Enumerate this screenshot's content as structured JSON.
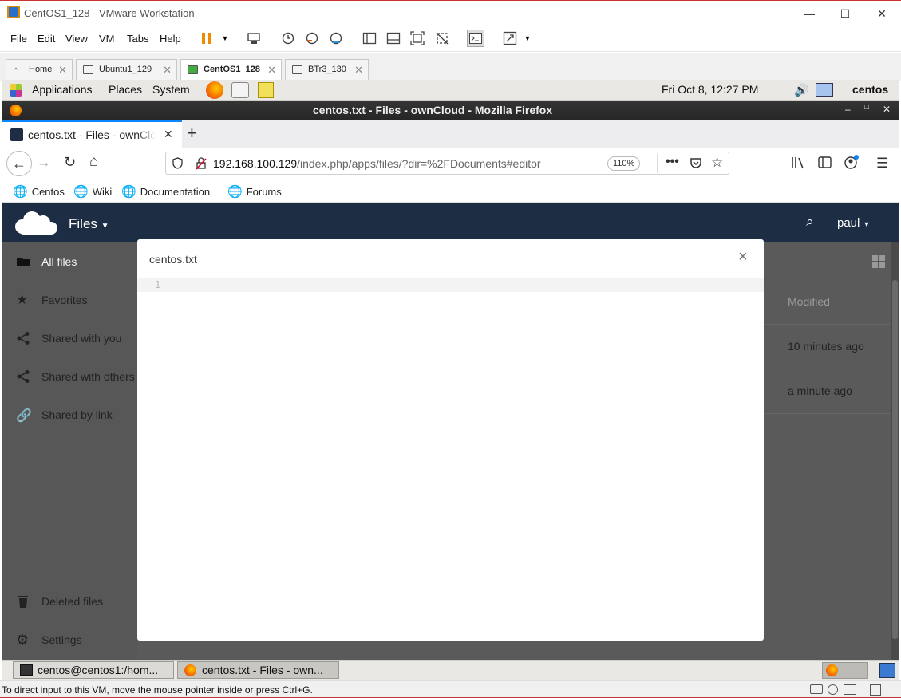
{
  "vmware": {
    "title": "CentOS1_128 - VMware Workstation",
    "menu": [
      "File",
      "Edit",
      "View",
      "VM",
      "Tabs",
      "Help"
    ],
    "tabs": [
      {
        "label": "Home"
      },
      {
        "label": "Ubuntu1_129"
      },
      {
        "label": "CentOS1_128",
        "active": true
      },
      {
        "label": "BTr3_130"
      }
    ],
    "status_message": "To direct input to this VM, move the mouse pointer inside or press Ctrl+G."
  },
  "gnome_panel": {
    "menus": [
      "Applications",
      "Places",
      "System"
    ],
    "clock": "Fri Oct  8, 12:27 PM",
    "user": "centos"
  },
  "firefox": {
    "window_title": "centos.txt - Files - ownCloud - Mozilla Firefox",
    "tab_title": "centos.txt - Files - ownCloud",
    "url_host": "192.168.100.129",
    "url_path": "/index.php/apps/files/?dir=%2FDocuments#editor",
    "zoom": "110%",
    "bookmarks": [
      "Centos",
      "Wiki",
      "Documentation",
      "Forums"
    ]
  },
  "owncloud": {
    "app_name": "Files",
    "user": "paul",
    "nav": [
      "All files",
      "Favorites",
      "Shared with you",
      "Shared with others",
      "Shared by link"
    ],
    "nav_bottom": [
      "Deleted files",
      "Settings"
    ],
    "column_modified": "Modified",
    "modified_values": [
      "10 minutes ago",
      "a minute ago"
    ]
  },
  "editor": {
    "filename": "centos.txt",
    "line_number": "1",
    "close_glyph": "×"
  },
  "taskbar": {
    "tasks": [
      "centos@centos1:/hom...",
      "centos.txt - Files - own..."
    ]
  }
}
